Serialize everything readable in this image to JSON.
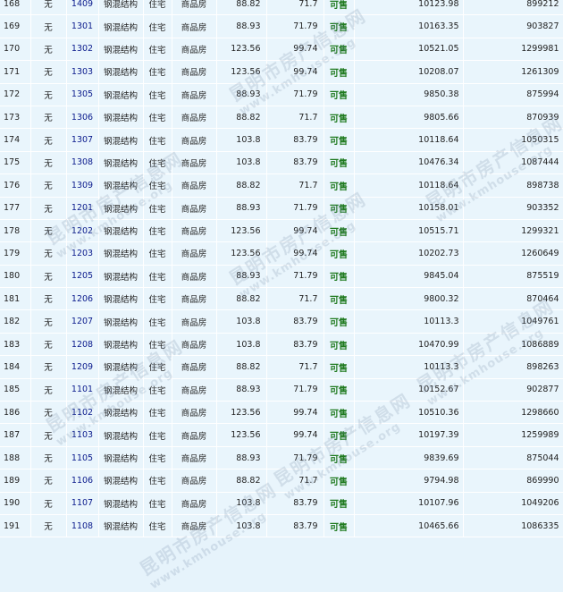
{
  "table": {
    "rows": [
      {
        "idx": "168",
        "no": "无",
        "room": "1409",
        "structure": "钢混结构",
        "use": "住宅",
        "type": "商品房",
        "area": "88.82",
        "inner": "71.7",
        "status": "可售",
        "unit_price": "10123.98",
        "total": "899212"
      },
      {
        "idx": "169",
        "no": "无",
        "room": "1301",
        "structure": "钢混结构",
        "use": "住宅",
        "type": "商品房",
        "area": "88.93",
        "inner": "71.79",
        "status": "可售",
        "unit_price": "10163.35",
        "total": "903827"
      },
      {
        "idx": "170",
        "no": "无",
        "room": "1302",
        "structure": "钢混结构",
        "use": "住宅",
        "type": "商品房",
        "area": "123.56",
        "inner": "99.74",
        "status": "可售",
        "unit_price": "10521.05",
        "total": "1299981"
      },
      {
        "idx": "171",
        "no": "无",
        "room": "1303",
        "structure": "钢混结构",
        "use": "住宅",
        "type": "商品房",
        "area": "123.56",
        "inner": "99.74",
        "status": "可售",
        "unit_price": "10208.07",
        "total": "1261309"
      },
      {
        "idx": "172",
        "no": "无",
        "room": "1305",
        "structure": "钢混结构",
        "use": "住宅",
        "type": "商品房",
        "area": "88.93",
        "inner": "71.79",
        "status": "可售",
        "unit_price": "9850.38",
        "total": "875994"
      },
      {
        "idx": "173",
        "no": "无",
        "room": "1306",
        "structure": "钢混结构",
        "use": "住宅",
        "type": "商品房",
        "area": "88.82",
        "inner": "71.7",
        "status": "可售",
        "unit_price": "9805.66",
        "total": "870939"
      },
      {
        "idx": "174",
        "no": "无",
        "room": "1307",
        "structure": "钢混结构",
        "use": "住宅",
        "type": "商品房",
        "area": "103.8",
        "inner": "83.79",
        "status": "可售",
        "unit_price": "10118.64",
        "total": "1050315"
      },
      {
        "idx": "175",
        "no": "无",
        "room": "1308",
        "structure": "钢混结构",
        "use": "住宅",
        "type": "商品房",
        "area": "103.8",
        "inner": "83.79",
        "status": "可售",
        "unit_price": "10476.34",
        "total": "1087444"
      },
      {
        "idx": "176",
        "no": "无",
        "room": "1309",
        "structure": "钢混结构",
        "use": "住宅",
        "type": "商品房",
        "area": "88.82",
        "inner": "71.7",
        "status": "可售",
        "unit_price": "10118.64",
        "total": "898738"
      },
      {
        "idx": "177",
        "no": "无",
        "room": "1201",
        "structure": "钢混结构",
        "use": "住宅",
        "type": "商品房",
        "area": "88.93",
        "inner": "71.79",
        "status": "可售",
        "unit_price": "10158.01",
        "total": "903352"
      },
      {
        "idx": "178",
        "no": "无",
        "room": "1202",
        "structure": "钢混结构",
        "use": "住宅",
        "type": "商品房",
        "area": "123.56",
        "inner": "99.74",
        "status": "可售",
        "unit_price": "10515.71",
        "total": "1299321"
      },
      {
        "idx": "179",
        "no": "无",
        "room": "1203",
        "structure": "钢混结构",
        "use": "住宅",
        "type": "商品房",
        "area": "123.56",
        "inner": "99.74",
        "status": "可售",
        "unit_price": "10202.73",
        "total": "1260649"
      },
      {
        "idx": "180",
        "no": "无",
        "room": "1205",
        "structure": "钢混结构",
        "use": "住宅",
        "type": "商品房",
        "area": "88.93",
        "inner": "71.79",
        "status": "可售",
        "unit_price": "9845.04",
        "total": "875519"
      },
      {
        "idx": "181",
        "no": "无",
        "room": "1206",
        "structure": "钢混结构",
        "use": "住宅",
        "type": "商品房",
        "area": "88.82",
        "inner": "71.7",
        "status": "可售",
        "unit_price": "9800.32",
        "total": "870464"
      },
      {
        "idx": "182",
        "no": "无",
        "room": "1207",
        "structure": "钢混结构",
        "use": "住宅",
        "type": "商品房",
        "area": "103.8",
        "inner": "83.79",
        "status": "可售",
        "unit_price": "10113.3",
        "total": "1049761"
      },
      {
        "idx": "183",
        "no": "无",
        "room": "1208",
        "structure": "钢混结构",
        "use": "住宅",
        "type": "商品房",
        "area": "103.8",
        "inner": "83.79",
        "status": "可售",
        "unit_price": "10470.99",
        "total": "1086889"
      },
      {
        "idx": "184",
        "no": "无",
        "room": "1209",
        "structure": "钢混结构",
        "use": "住宅",
        "type": "商品房",
        "area": "88.82",
        "inner": "71.7",
        "status": "可售",
        "unit_price": "10113.3",
        "total": "898263"
      },
      {
        "idx": "185",
        "no": "无",
        "room": "1101",
        "structure": "钢混结构",
        "use": "住宅",
        "type": "商品房",
        "area": "88.93",
        "inner": "71.79",
        "status": "可售",
        "unit_price": "10152.67",
        "total": "902877"
      },
      {
        "idx": "186",
        "no": "无",
        "room": "1102",
        "structure": "钢混结构",
        "use": "住宅",
        "type": "商品房",
        "area": "123.56",
        "inner": "99.74",
        "status": "可售",
        "unit_price": "10510.36",
        "total": "1298660"
      },
      {
        "idx": "187",
        "no": "无",
        "room": "1103",
        "structure": "钢混结构",
        "use": "住宅",
        "type": "商品房",
        "area": "123.56",
        "inner": "99.74",
        "status": "可售",
        "unit_price": "10197.39",
        "total": "1259989"
      },
      {
        "idx": "188",
        "no": "无",
        "room": "1105",
        "structure": "钢混结构",
        "use": "住宅",
        "type": "商品房",
        "area": "88.93",
        "inner": "71.79",
        "status": "可售",
        "unit_price": "9839.69",
        "total": "875044"
      },
      {
        "idx": "189",
        "no": "无",
        "room": "1106",
        "structure": "钢混结构",
        "use": "住宅",
        "type": "商品房",
        "area": "88.82",
        "inner": "71.7",
        "status": "可售",
        "unit_price": "9794.98",
        "total": "869990"
      },
      {
        "idx": "190",
        "no": "无",
        "room": "1107",
        "structure": "钢混结构",
        "use": "住宅",
        "type": "商品房",
        "area": "103.8",
        "inner": "83.79",
        "status": "可售",
        "unit_price": "10107.96",
        "total": "1049206"
      },
      {
        "idx": "191",
        "no": "无",
        "room": "1108",
        "structure": "钢混结构",
        "use": "住宅",
        "type": "商品房",
        "area": "103.8",
        "inner": "83.79",
        "status": "可售",
        "unit_price": "10465.66",
        "total": "1086335"
      }
    ]
  },
  "watermark": {
    "text_cn": "昆明市房产信息网",
    "text_en": "www.kmhouse.org"
  },
  "colors": {
    "background": "#e6f3fb",
    "status_available": "#1f7a1f",
    "room_link": "#0a1a8c"
  }
}
